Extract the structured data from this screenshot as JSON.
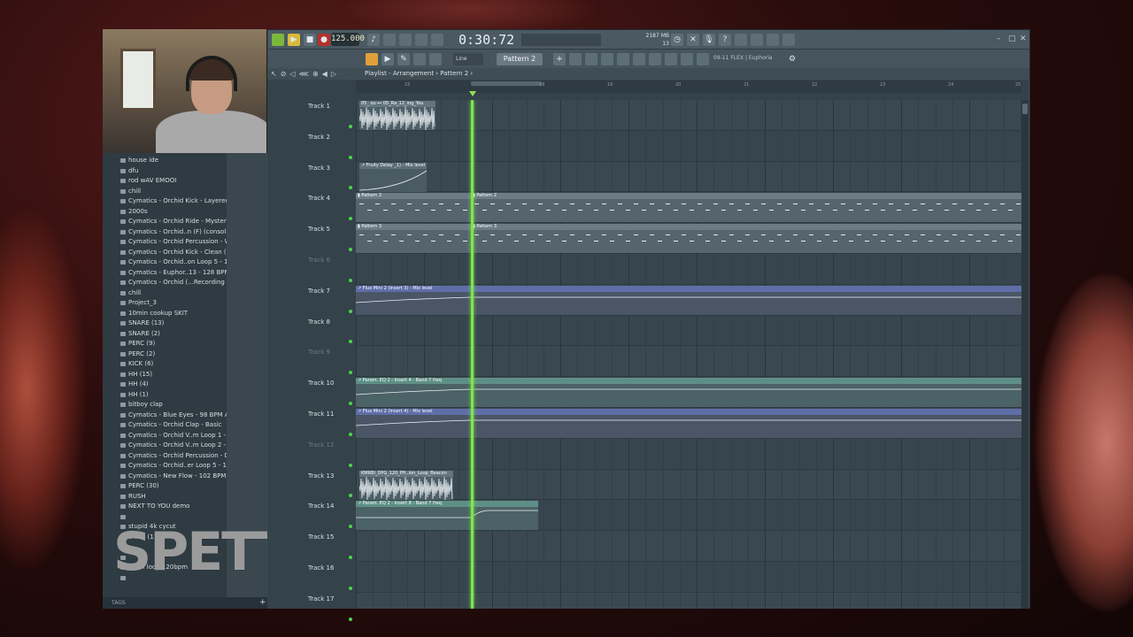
{
  "toolbar": {
    "tempo": "125.000",
    "time": "0:30:72",
    "memory_top": "2187 MB",
    "memory_bottom": "13",
    "cpu_value": "25",
    "pattern": "Pattern 2",
    "snap": "Line",
    "plugin": "09-11 FLEX | Euphoria"
  },
  "playlist": {
    "title": "Playlist - Arrangement › Pattern 2 ›",
    "ruler_numbers": [
      "15",
      "18",
      "19",
      "20",
      "21",
      "22",
      "23",
      "24",
      "25"
    ],
    "tracks": [
      {
        "name": "Track 1",
        "muted": false
      },
      {
        "name": "Track 2",
        "muted": false
      },
      {
        "name": "Track 3",
        "muted": false
      },
      {
        "name": "Track 4",
        "muted": false
      },
      {
        "name": "Track 5",
        "muted": false
      },
      {
        "name": "Track 6",
        "muted": true
      },
      {
        "name": "Track 7",
        "muted": false
      },
      {
        "name": "Track 8",
        "muted": false
      },
      {
        "name": "Track 9",
        "muted": true
      },
      {
        "name": "Track 10",
        "muted": false
      },
      {
        "name": "Track 11",
        "muted": false
      },
      {
        "name": "Track 12",
        "muted": true
      },
      {
        "name": "Track 13",
        "muted": false
      },
      {
        "name": "Track 14",
        "muted": false
      },
      {
        "name": "Track 15",
        "muted": false
      },
      {
        "name": "Track 16",
        "muted": false
      },
      {
        "name": "Track 17",
        "muted": false
      }
    ],
    "clips": [
      {
        "label": "05_ ou ⊷ 05_Ra_12_ing_You"
      },
      {
        "label": "↗ Fruity Delay _1) - Mix level"
      },
      {
        "label": "▮ Pattern 2"
      },
      {
        "label": "▮ Pattern 2"
      },
      {
        "label": "▮ Pattern 3"
      },
      {
        "label": "▮ Pattern 3"
      },
      {
        "label": "↗ Flux Mini 2 (Insert 3) - Mix level"
      },
      {
        "label": "↗ Param. EQ 2 - Insert 4 - Band 7 freq"
      },
      {
        "label": "↗ Flux Mini 2 (Insert 4) - Mix level"
      },
      {
        "label": "KMRBI_DPG_120_PH..ion_Loop_Beacon"
      },
      {
        "label": "↗ Param. EQ 2 - Insert 8 - Band 7 freq"
      }
    ]
  },
  "browser": {
    "items": [
      "house ide",
      "dfu",
      "rod wAV EMOOI",
      "chill",
      "Cymatics - Orchid Kick - Layered (F#)",
      "2000s",
      "Cymatics - Orchid Ride - Mysterious",
      "Cymatics - Orchid..n (F) (consolidated)",
      "Cymatics - Orchid Percussion - Wet 4",
      "Cymatics - Orchid Kick - Clean (F)",
      "Cymatics - Orchid..on Loop 5 - 109 BPM",
      "Cymatics - Euphor..13 - 128 BPM E Min",
      "Cymatics - Orchid (...Recording - Waves",
      "chill",
      "Project_3",
      "10min cookup SKIT",
      "SNARE (13)",
      "SNARE (2)",
      "PERC (9)",
      "PERC (2)",
      "KICK (6)",
      "HH (15)",
      "HH (4)",
      "HH (1)",
      "bitboy clap",
      "Cymatics - Blue Eyes - 98 BPM A Min",
      "Cymatics - Orchid Clap - Basic",
      "Cymatics - Orchid V..m Loop 1 - 90 BPM",
      "Cymatics - Orchid V..m Loop 2 - 97 BPM",
      "Cymatics - Orchid Percussion - Dry 1",
      "Cymatics - Orchid..er Loop 5 - 104 BPM",
      "Cymatics - New Flow - 102 BPM F Min",
      "PERC (30)",
      "RUSH",
      "NEXT TO YOU demo",
      "",
      "stupid 4k cycut",
      "SNAR (1)",
      "",
      "",
      "drum loop 120bpm",
      ""
    ],
    "footer": "TAGS"
  },
  "watermark": "SPETT"
}
